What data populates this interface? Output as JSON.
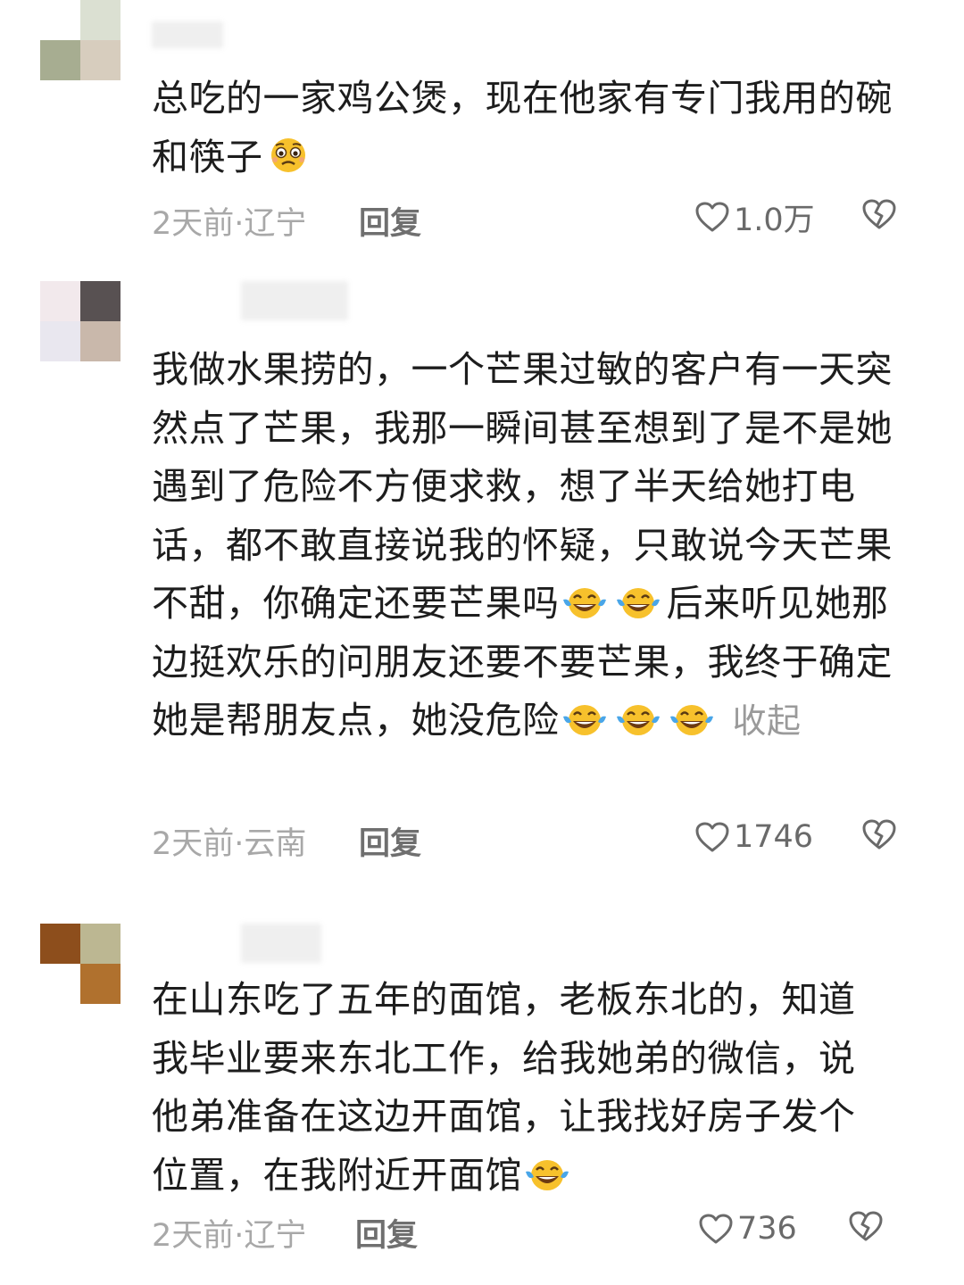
{
  "comments": [
    {
      "text": "总吃的一家鸡公煲，现在他家有专门我用的碗和筷子",
      "emoji_after": [
        "pleading-face-icon"
      ],
      "time_location": "2天前·辽宁",
      "reply_label": "回复",
      "likes": "1.0万",
      "avatar_colors": [
        "#ffffff",
        "#dbe0d2",
        "#a7ad91",
        "#d7cdbe"
      ]
    },
    {
      "text_part1": "我做水果捞的，一个芒果过敏的客户有一天突然点了芒果，我那一瞬间甚至想到了是不是她遇到了危险不方便求救，想了半天给她打电话，都不敢直接说我的怀疑，只敢说今天芒果不甜，你确定还要芒果吗",
      "text_part2": "后来听见她那边挺欢乐的问朋友还要不要芒果，我终于确定她是帮朋友点，她没危险",
      "collapse_label": "收起",
      "time_location": "2天前·云南",
      "reply_label": "回复",
      "likes": "1746",
      "avatar_colors": [
        "#f2e9ec",
        "#585152",
        "#e9e7ef",
        "#c9b8ab"
      ]
    },
    {
      "text": "在山东吃了五年的面馆，老板东北的，知道我毕业要来东北工作，给我她弟的微信，说他弟准备在这边开面馆，让我找好房子发个位置，在我附近开面馆",
      "emoji_after": [
        "joy-tears-icon"
      ],
      "time_location": "2天前·辽宁",
      "reply_label": "回复",
      "likes": "736",
      "avatar_colors": [
        "#8d4e1c",
        "#bcb792",
        "#ffffff",
        "#b0712e"
      ]
    }
  ],
  "colors": {
    "text": "#1d1d1d",
    "meta": "#a8a8a8",
    "reply": "#6f6f6f",
    "collapse": "#9a9a9a",
    "emoji_yellow": "#f7c12c",
    "emoji_tear": "#4aa6e8"
  }
}
